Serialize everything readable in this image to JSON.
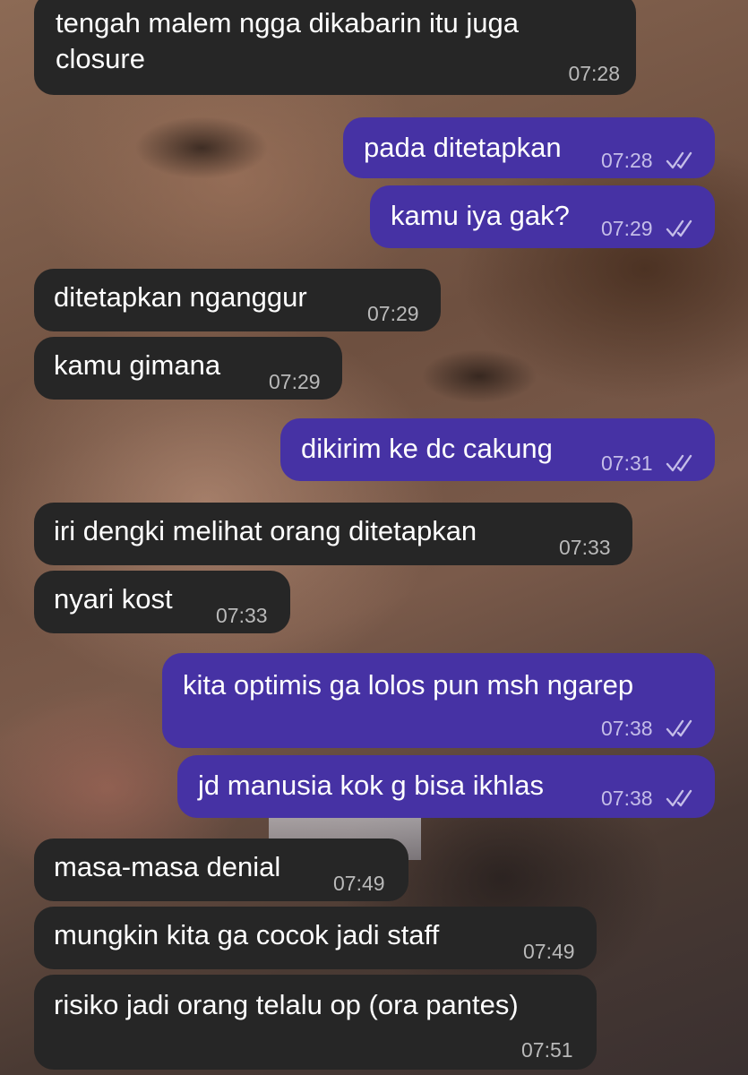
{
  "messages": [
    {
      "direction": "in",
      "text": "tengah malem ngga dikabarin itu juga",
      "text2": "closure",
      "time": "07:28"
    },
    {
      "direction": "out",
      "text": "pada ditetapkan",
      "time": "07:28",
      "status": "read"
    },
    {
      "direction": "out",
      "text": "kamu iya gak?",
      "time": "07:29",
      "status": "read"
    },
    {
      "direction": "in",
      "text": "ditetapkan nganggur",
      "time": "07:29"
    },
    {
      "direction": "in",
      "text": "kamu gimana",
      "time": "07:29"
    },
    {
      "direction": "out",
      "text": "dikirim ke dc cakung",
      "time": "07:31",
      "status": "read"
    },
    {
      "direction": "in",
      "text": "iri dengki melihat orang ditetapkan",
      "time": "07:33"
    },
    {
      "direction": "in",
      "text": "nyari kost",
      "time": "07:33"
    },
    {
      "direction": "out",
      "text": "kita optimis ga lolos pun msh ngarep",
      "time": "07:38",
      "status": "read"
    },
    {
      "direction": "out",
      "text": "jd manusia kok g bisa ikhlas",
      "time": "07:38",
      "status": "read"
    },
    {
      "direction": "in",
      "text": "masa-masa denial",
      "time": "07:49"
    },
    {
      "direction": "in",
      "text": "mungkin kita ga cocok jadi staff",
      "time": "07:49"
    },
    {
      "direction": "in",
      "text": "risiko jadi orang telalu op (ora pantes)",
      "time": "07:51"
    }
  ],
  "colors": {
    "incoming_bubble": "#262626",
    "outgoing_bubble": "#4632a4",
    "text": "#ffffff"
  },
  "icons": {
    "read_status": "double-check-icon"
  }
}
